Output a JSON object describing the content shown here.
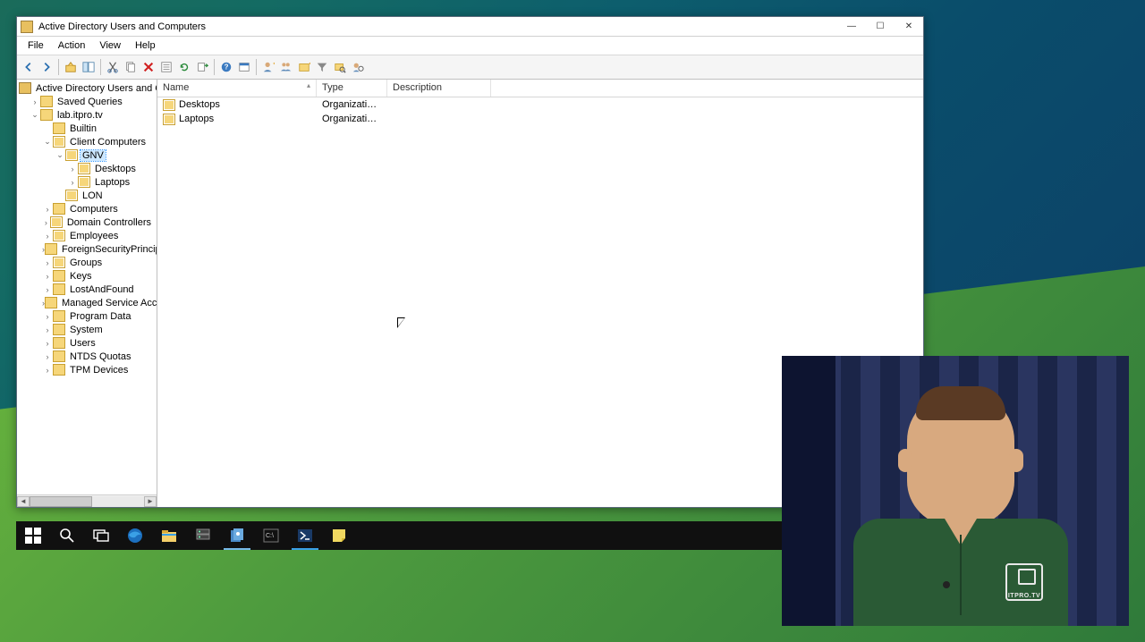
{
  "window": {
    "title": "Active Directory Users and Computers",
    "menu": [
      "File",
      "Action",
      "View",
      "Help"
    ]
  },
  "columns": {
    "name": "Name",
    "type": "Type",
    "description": "Description"
  },
  "listItems": [
    {
      "name": "Desktops",
      "type": "Organizational...",
      "description": ""
    },
    {
      "name": "Laptops",
      "type": "Organizational...",
      "description": ""
    }
  ],
  "tree": {
    "root": "Active Directory Users and Computers",
    "savedQueries": "Saved Queries",
    "domain": "lab.itpro.tv",
    "nodes": {
      "builtin": "Builtin",
      "clientComputers": "Client Computers",
      "gnv": "GNV",
      "gnvDesktops": "Desktops",
      "gnvLaptops": "Laptops",
      "lon": "LON",
      "computers": "Computers",
      "domainControllers": "Domain Controllers",
      "employees": "Employees",
      "fsp": "ForeignSecurityPrincipals",
      "groups": "Groups",
      "keys": "Keys",
      "lostAndFound": "LostAndFound",
      "msa": "Managed Service Accounts",
      "programData": "Program Data",
      "system": "System",
      "users": "Users",
      "ntds": "NTDS Quotas",
      "tpm": "TPM Devices"
    }
  },
  "webcam": {
    "logoText": "ITPRO.TV"
  }
}
